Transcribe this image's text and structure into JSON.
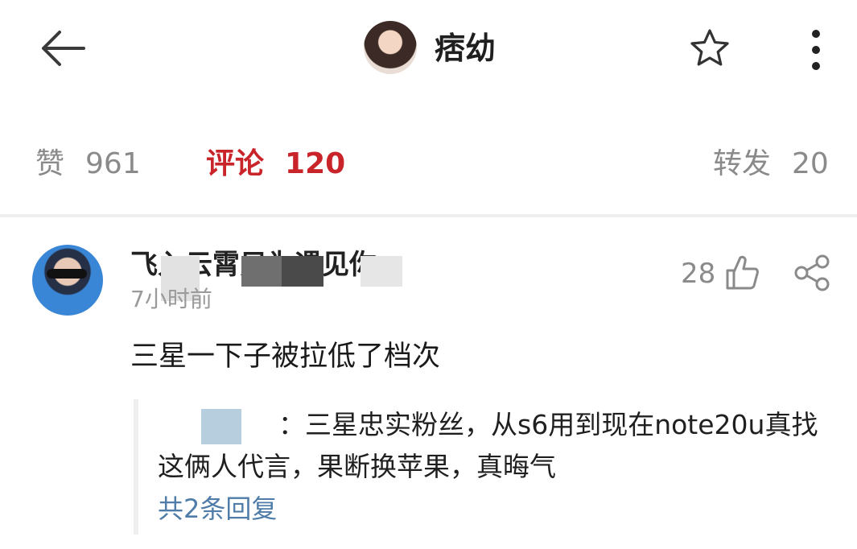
{
  "header": {
    "title": "痞幼",
    "back_icon": "arrow-left-icon",
    "favorite_icon": "star-outline-icon",
    "more_icon": "vertical-ellipsis-icon"
  },
  "stats": {
    "likes_label": "赞",
    "likes_count": "961",
    "comments_label": "评论",
    "comments_count": "120",
    "reposts_label": "转发",
    "reposts_count": "20"
  },
  "colors": {
    "accent_red": "#c8242a",
    "link_blue": "#4f7ca8",
    "muted_gray": "#8a8a8a",
    "divider": "#eeeeee"
  },
  "comment": {
    "username": "飞入云霄只为遇见你",
    "time": "7小时前",
    "like_count": "28",
    "like_icon": "thumbs-up-icon",
    "share_icon": "share-icon",
    "text": "三星一下子被拉低了档次",
    "reply": {
      "text": "：三星忠实粉丝，从s6用到现在note20u真找这俩人代言，果断换苹果，真晦气",
      "more_label": "共2条回复"
    }
  }
}
